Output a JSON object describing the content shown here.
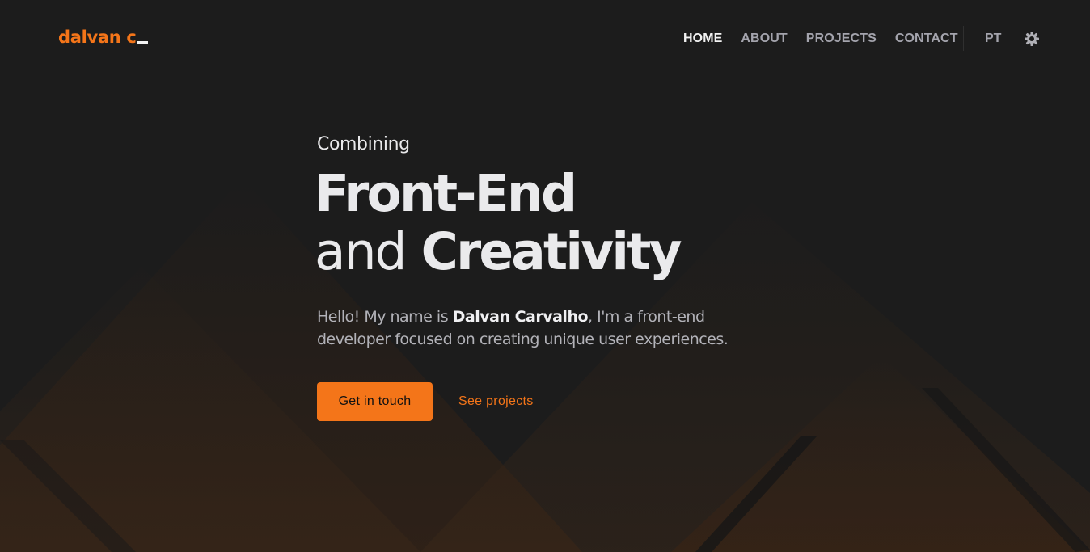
{
  "colors": {
    "background": "#1c1c1c",
    "accent": "#f47519",
    "text": "#eaeaec",
    "muted": "#a4a4ad"
  },
  "header": {
    "logo": "dalvan c",
    "nav": [
      {
        "label": "HOME",
        "active": true
      },
      {
        "label": "ABOUT",
        "active": false
      },
      {
        "label": "PROJECTS",
        "active": false
      },
      {
        "label": "CONTACT",
        "active": false
      }
    ],
    "language": "PT",
    "theme_icon": "sun-gear-icon"
  },
  "hero": {
    "eyebrow": "Combining",
    "line1": "Front-End",
    "line2_light": "and",
    "line2_bold": "Creativity",
    "intro_before": "Hello! My name is ",
    "intro_name": "Dalvan Carvalho",
    "intro_after": ", I'm a front-end developer focused on creating unique user experiences.",
    "primary_button": "Get in touch",
    "secondary_link": "See projects"
  }
}
